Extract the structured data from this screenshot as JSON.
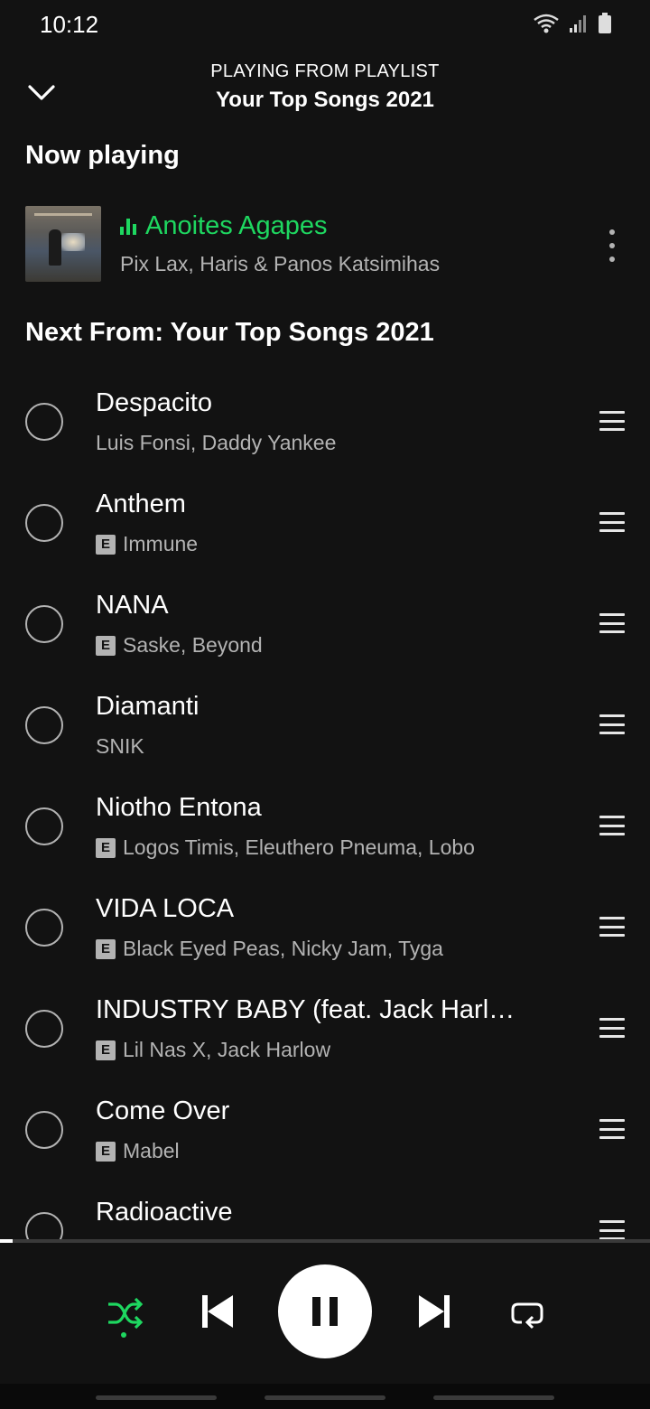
{
  "status": {
    "time": "10:12"
  },
  "header": {
    "subtitle": "PLAYING FROM PLAYLIST",
    "title": "Your Top Songs 2021"
  },
  "now_playing": {
    "section": "Now playing",
    "title": "Anoites Agapes",
    "artist": "Pix Lax, Haris & Panos Katsimihas"
  },
  "next": {
    "section": "Next From: Your Top Songs 2021",
    "explicit_label": "E",
    "tracks": [
      {
        "title": "Despacito",
        "artist": "Luis Fonsi, Daddy Yankee",
        "explicit": false
      },
      {
        "title": "Anthem",
        "artist": "Immune",
        "explicit": true
      },
      {
        "title": "NANA",
        "artist": "Saske, Beyond",
        "explicit": true
      },
      {
        "title": "Diamanti",
        "artist": "SNIK",
        "explicit": false
      },
      {
        "title": "Niotho Entona",
        "artist": "Logos Timis, Eleuthero Pneuma, Lobo",
        "explicit": true
      },
      {
        "title": "VIDA LOCA",
        "artist": "Black Eyed Peas, Nicky Jam, Tyga",
        "explicit": true
      },
      {
        "title": "INDUSTRY BABY (feat. Jack Harl…",
        "artist": "Lil Nas X, Jack Harlow",
        "explicit": true
      },
      {
        "title": "Come Over",
        "artist": "Mabel",
        "explicit": true
      },
      {
        "title": "Radioactive",
        "artist": "",
        "explicit": false
      }
    ]
  },
  "player": {
    "shuffle_active": true,
    "state": "playing",
    "progress": 0.02
  },
  "colors": {
    "accent": "#1ed760",
    "background": "#121212",
    "secondary_text": "#b3b3b3"
  },
  "icons": [
    "wifi-icon",
    "signal-icon",
    "battery-icon",
    "chevron-down-icon",
    "equalizer-icon",
    "more-vertical-icon",
    "drag-handle-icon",
    "shuffle-icon",
    "skip-previous-icon",
    "pause-icon",
    "skip-next-icon",
    "repeat-icon"
  ]
}
